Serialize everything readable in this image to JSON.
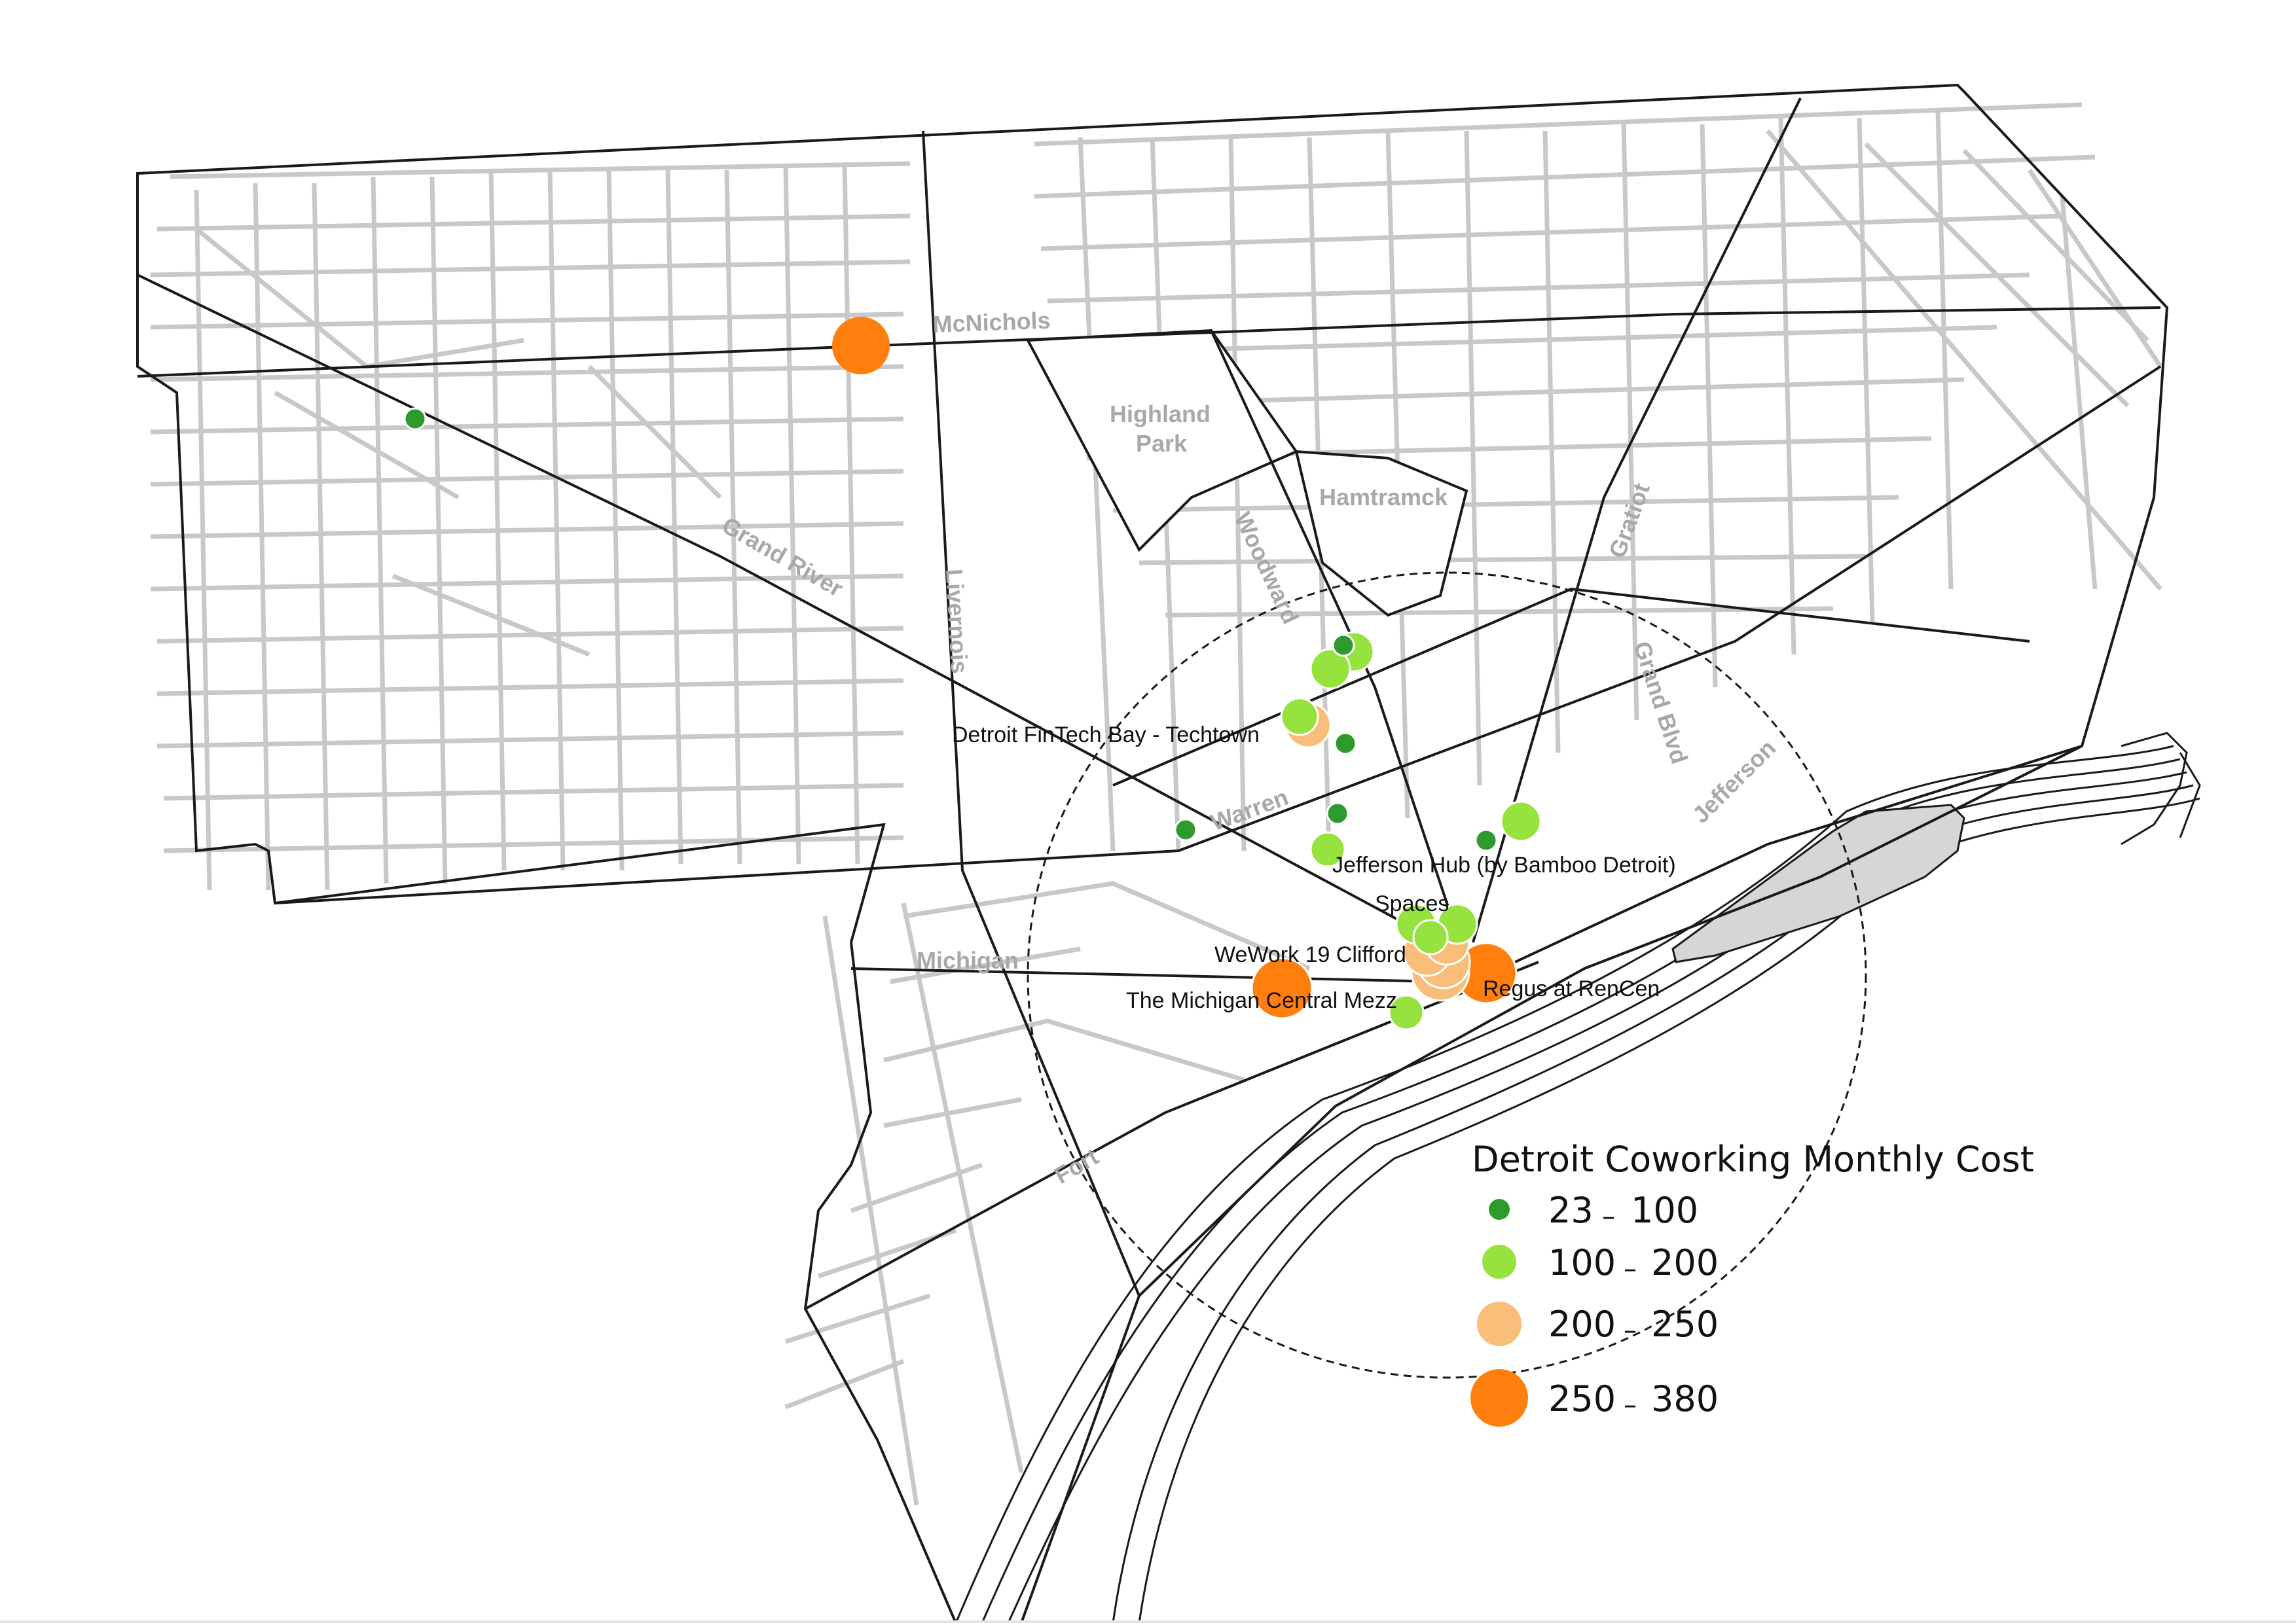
{
  "legend": {
    "title": "Detroit Coworking Monthly Cost",
    "classes": [
      {
        "min": "23",
        "max": "100",
        "color": "#2e9a2e",
        "size_class": "small"
      },
      {
        "min": "100",
        "max": "200",
        "color": "#96e23e",
        "size_class": "medium"
      },
      {
        "min": "200",
        "max": "250",
        "color": "#f9bd7a",
        "size_class": "large"
      },
      {
        "min": "250",
        "max": "380",
        "color": "#ff7f0e",
        "size_class": "xlarge"
      }
    ]
  },
  "streets": {
    "mcnichols": "McNichols",
    "grand_river": "Grand River",
    "livernois": "Livernois",
    "woodward": "Woodward",
    "gratiot": "Gratiot",
    "grand_blvd": "Grand Blvd",
    "jefferson": "Jefferson",
    "warren": "Warren",
    "michigan": "Michigan",
    "fort": "Fort"
  },
  "areas": {
    "highland_park_1": "Highland",
    "highland_park_2": "Park",
    "hamtramck": "Hamtramck"
  },
  "places": {
    "techtown": "Detroit FinTech Bay - Techtown",
    "jefferson_hub": "Jefferson Hub (by Bamboo Detroit)",
    "spaces": "Spaces",
    "wework": "WeWork 19 Clifford",
    "michigan_central": "The Michigan Central Mezz",
    "regus": "Regus at RenCen"
  },
  "colors": {
    "boundary": "#1a1a1a",
    "streets": "#c8c8c8",
    "water": "#d6d6d6",
    "label_gray": "#a8a8a8"
  }
}
